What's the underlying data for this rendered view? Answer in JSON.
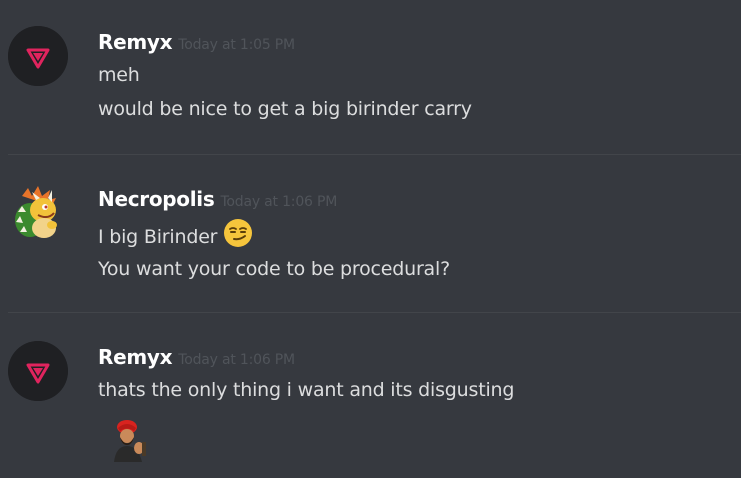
{
  "messages": [
    {
      "author": "Remyx",
      "timestamp": "Today at 1:05 PM",
      "lines": [
        "meh",
        "would be nice to get a big birinder carry"
      ]
    },
    {
      "author": "Necropolis",
      "timestamp": "Today at 1:06 PM",
      "lines": [
        "I big Birinder",
        "You want your code to be procedural?"
      ],
      "emoji": "smirk-emoji"
    },
    {
      "author": "Remyx",
      "timestamp": "Today at 1:06 PM",
      "lines": [
        "thats the only thing i want and its disgusting"
      ],
      "attachment": "birinder-sticker-image"
    }
  ],
  "colors": {
    "background": "#36393f",
    "username": "#ffffff",
    "timestamp": "#50545a",
    "text": "#dcddde",
    "remyx_logo": "#e0245e",
    "divider": "#42454a"
  }
}
